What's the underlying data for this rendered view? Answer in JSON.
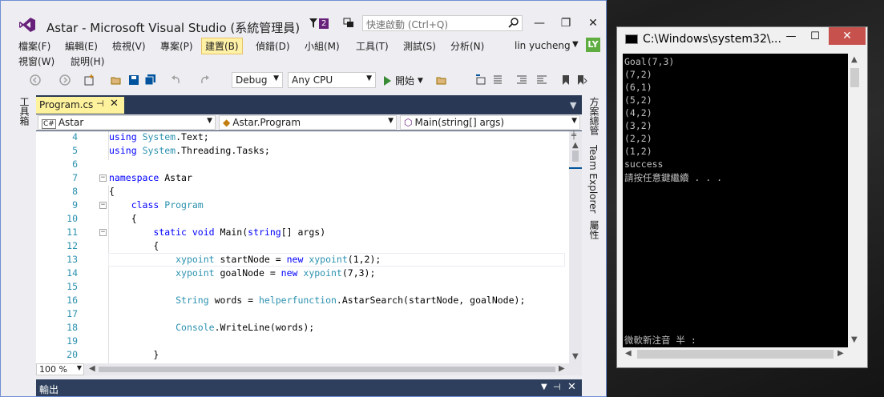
{
  "vs": {
    "title": "Astar - Microsoft Visual Studio (系統管理員)",
    "notification_count": "2",
    "quick_launch_placeholder": "快速啟動 (Ctrl+Q)",
    "window_buttons": [
      "—",
      "❐",
      "✕"
    ],
    "menu_row1": [
      "檔案(F)",
      "編輯(E)",
      "檢視(V)",
      "專案(P)",
      "建置(B)",
      "偵錯(D)",
      "小組(M)",
      "工具(T)",
      "測試(S)",
      "分析(N)"
    ],
    "menu_row2": [
      "視窗(W)",
      "說明(H)"
    ],
    "active_menu": "建置(B)",
    "user_name": "lin yucheng",
    "user_initials": "LY",
    "toolbar": {
      "config": "Debug",
      "platform": "Any CPU",
      "run_label": "開始"
    },
    "left_sidebar": "工具箱",
    "right_sidebar": [
      "方案總管",
      "Team Explorer",
      "屬性"
    ],
    "doc_tab": "Program.cs",
    "nav": {
      "project": "Astar",
      "class": "Astar.Program",
      "member": "Main(string[] args)"
    },
    "zoom": "100 %",
    "output_title": "輸出",
    "colors": {
      "accent": "#68217a",
      "tab_active": "#fff29d",
      "doc_well": "#293955",
      "keyword": "#0000ff",
      "type": "#2b91af"
    },
    "code_lines": [
      {
        "n": "4",
        "t": "using System.Text;"
      },
      {
        "n": "5",
        "t": "using System.Threading.Tasks;"
      },
      {
        "n": "6",
        "t": ""
      },
      {
        "n": "7",
        "t": "namespace Astar"
      },
      {
        "n": "8",
        "t": "{"
      },
      {
        "n": "9",
        "t": "    class Program"
      },
      {
        "n": "10",
        "t": "    {"
      },
      {
        "n": "11",
        "t": "        static void Main(string[] args)"
      },
      {
        "n": "12",
        "t": "        {"
      },
      {
        "n": "13",
        "t": "            xypoint startNode = new xypoint(1,2);"
      },
      {
        "n": "14",
        "t": "            xypoint goalNode = new xypoint(7,3);"
      },
      {
        "n": "15",
        "t": ""
      },
      {
        "n": "16",
        "t": "            String words = helperfunction.AstarSearch(startNode, goalNode);"
      },
      {
        "n": "17",
        "t": ""
      },
      {
        "n": "18",
        "t": "            Console.WriteLine(words);"
      },
      {
        "n": "19",
        "t": ""
      },
      {
        "n": "20",
        "t": "        }"
      }
    ]
  },
  "console": {
    "title": "C:\\Windows\\system32\\...",
    "lines": [
      "Goal(7,3)",
      "(7,2)",
      "(6,1)",
      "(5,2)",
      "(4,2)",
      "(3,2)",
      "(2,2)",
      "(1,2)",
      "success",
      "請按任意鍵繼續 . . ."
    ],
    "ime_status": "微軟新注音 半 :"
  }
}
